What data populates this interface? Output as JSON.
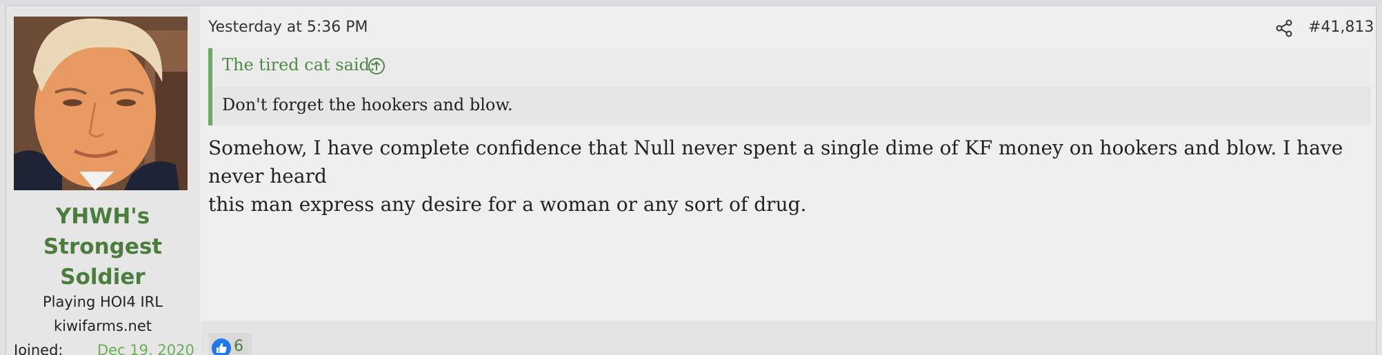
{
  "user": {
    "name_lines": [
      "YHWH's",
      "Strongest",
      "Soldier"
    ],
    "title": "Playing HOI4 IRL",
    "site": "kiwifarms.net",
    "joined_label": "Joined:",
    "joined_value": "Dec 19, 2020"
  },
  "post": {
    "timestamp": "Yesterday at 5:36 PM",
    "share_icon": "share-icon",
    "number": "#41,813",
    "quote": {
      "author": "The tired cat said:",
      "expand_icon": "circle-arrow-up-icon",
      "text": "Don't forget the hookers and blow."
    },
    "message_lines": [
      "Somehow, I have complete confidence that Null never spent a single dime of KF money on hookers and blow. I have never heard",
      "this man express any desire for a woman or any sort of drug."
    ]
  },
  "reactions": {
    "like_icon": "thumbs-up-icon",
    "count": "6"
  },
  "colors": {
    "username": "#4b7d3c",
    "quote_border": "#6fa866",
    "joined_value": "#6aae58",
    "like_blue": "#1e7ae8"
  }
}
